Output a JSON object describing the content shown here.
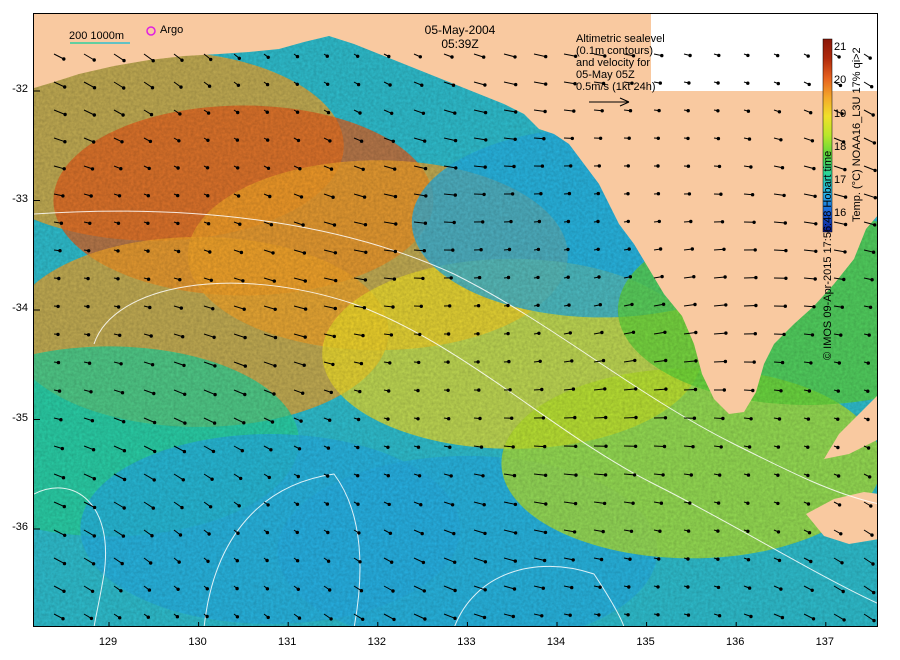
{
  "header": {
    "date": "05-May-2004",
    "time": "05:39Z"
  },
  "legend_note": {
    "lines": [
      "Altimetric sealevel",
      "(0.1m contours)",
      "and velocity for",
      "05-May 05Z",
      "0.5m/s (1kt 24h)"
    ]
  },
  "scale_label": "200  1000m",
  "argo_label": "Argo",
  "colorbar": {
    "title": "Temp. (°C) NOAA16_L3U 17% qi>2",
    "ticks": [
      "21",
      "20",
      "19",
      "18",
      "17",
      "16"
    ],
    "colors": [
      "#0b1a8c",
      "#1a5fd6",
      "#27b2e6",
      "#29d49a",
      "#5fd63a",
      "#b8e62a",
      "#f0e02a",
      "#f4a62a",
      "#e5601e",
      "#b02a0c",
      "#8a1608"
    ]
  },
  "credit": "© IMOS 09-Apr-2015 17:56:48 Hobart time",
  "axes": {
    "x_ticks": [
      "129",
      "130",
      "131",
      "132",
      "133",
      "134",
      "135",
      "136",
      "137"
    ],
    "y_ticks": [
      "-32",
      "-33",
      "-34",
      "-35",
      "-36"
    ],
    "land_color": "#f9c9a0"
  },
  "chart_data": {
    "type": "heatmap",
    "title": "",
    "xlabel": "",
    "ylabel": "",
    "xlim": [
      128.2,
      137.6
    ],
    "ylim": [
      -36.9,
      -31.3
    ],
    "colorscale_range": [
      15.5,
      21.3
    ],
    "temperature_zones": [
      {
        "lon": 129.5,
        "lat": -32.5,
        "value": 19.8
      },
      {
        "lon": 130.5,
        "lat": -33.0,
        "value": 20.0
      },
      {
        "lon": 132.0,
        "lat": -33.5,
        "value": 19.6
      },
      {
        "lon": 130.0,
        "lat": -34.2,
        "value": 19.4
      },
      {
        "lon": 133.5,
        "lat": -34.4,
        "value": 18.8
      },
      {
        "lon": 134.5,
        "lat": -33.2,
        "value": 16.5
      },
      {
        "lon": 129.0,
        "lat": -35.2,
        "value": 17.3
      },
      {
        "lon": 130.8,
        "lat": -36.0,
        "value": 16.8
      },
      {
        "lon": 133.0,
        "lat": -36.2,
        "value": 16.6
      },
      {
        "lon": 135.5,
        "lat": -35.4,
        "value": 18.4
      },
      {
        "lon": 136.8,
        "lat": -34.0,
        "value": 17.8
      }
    ]
  }
}
